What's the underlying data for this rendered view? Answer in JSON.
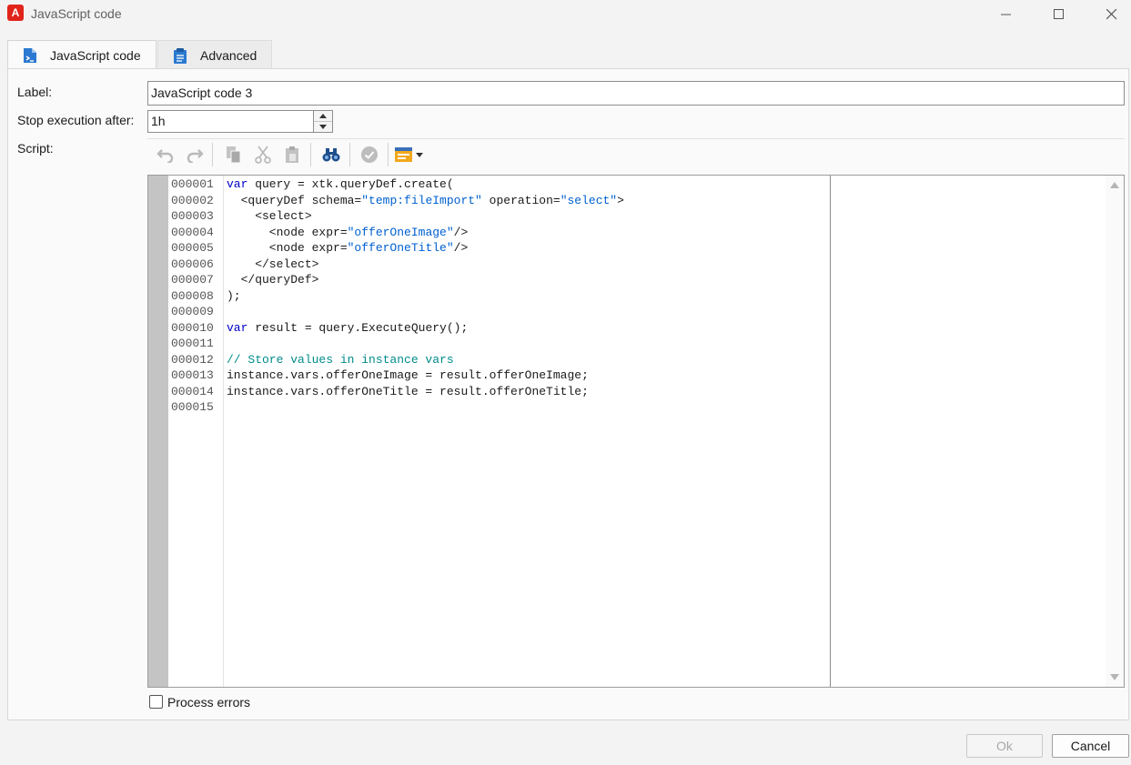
{
  "window": {
    "title": "JavaScript code",
    "app_icon_glyph": "A",
    "accent_color": "#e1251b"
  },
  "tabs": [
    {
      "label": "JavaScript code",
      "icon": "script-file-icon",
      "active": true
    },
    {
      "label": "Advanced",
      "icon": "clipboard-icon",
      "active": false
    }
  ],
  "form": {
    "label_caption": "Label:",
    "label_value": "JavaScript code 3",
    "stop_caption": "Stop execution after:",
    "stop_value": "1h",
    "script_caption": "Script:"
  },
  "toolbar": {
    "icons": [
      "undo-icon",
      "redo-icon",
      "copy-icon",
      "cut-icon",
      "paste-icon",
      "find-icon",
      "check-syntax-icon",
      "insert-field-icon"
    ]
  },
  "editor": {
    "line_numbers": [
      "000001",
      "000002",
      "000003",
      "000004",
      "000005",
      "000006",
      "000007",
      "000008",
      "000009",
      "000010",
      "000011",
      "000012",
      "000013",
      "000014",
      "000015"
    ],
    "lines": [
      [
        {
          "t": "var",
          "c": "kw"
        },
        {
          "t": " query = xtk.queryDef.create(",
          "c": ""
        }
      ],
      [
        {
          "t": "  <queryDef schema=",
          "c": ""
        },
        {
          "t": "\"temp:fileImport\"",
          "c": "str"
        },
        {
          "t": " operation=",
          "c": ""
        },
        {
          "t": "\"select\"",
          "c": "str"
        },
        {
          "t": ">",
          "c": ""
        }
      ],
      [
        {
          "t": "    <select>",
          "c": ""
        }
      ],
      [
        {
          "t": "      <node expr=",
          "c": ""
        },
        {
          "t": "\"offerOneImage\"",
          "c": "str"
        },
        {
          "t": "/>",
          "c": ""
        }
      ],
      [
        {
          "t": "      <node expr=",
          "c": ""
        },
        {
          "t": "\"offerOneTitle\"",
          "c": "str"
        },
        {
          "t": "/>",
          "c": ""
        }
      ],
      [
        {
          "t": "    </select>",
          "c": ""
        }
      ],
      [
        {
          "t": "  </queryDef>",
          "c": ""
        }
      ],
      [
        {
          "t": ");",
          "c": ""
        }
      ],
      [],
      [
        {
          "t": "var",
          "c": "kw"
        },
        {
          "t": " result = query.ExecuteQuery();",
          "c": ""
        }
      ],
      [],
      [
        {
          "t": "// Store values in instance vars",
          "c": "cmt"
        }
      ],
      [
        {
          "t": "instance.vars.offerOneImage = result.offerOneImage;",
          "c": ""
        }
      ],
      [
        {
          "t": "instance.vars.offerOneTitle = result.offerOneTitle;",
          "c": ""
        }
      ],
      []
    ]
  },
  "process_errors": {
    "label": "Process errors",
    "checked": false
  },
  "buttons": {
    "ok": "Ok",
    "cancel": "Cancel"
  }
}
